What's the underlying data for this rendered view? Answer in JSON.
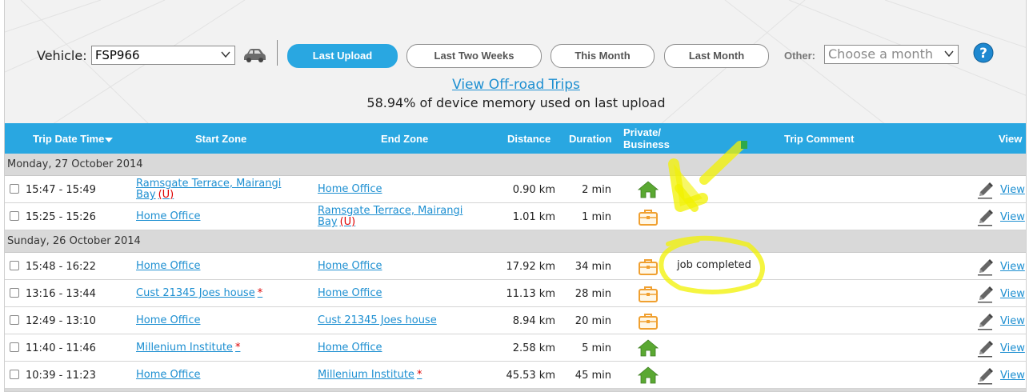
{
  "toolbar": {
    "vehicle_label": "Vehicle:",
    "vehicle_value": "FSP966",
    "buttons": [
      "Last Upload",
      "Last Two Weeks",
      "This Month",
      "Last Month"
    ],
    "active_button": "Last Upload",
    "other_label": "Other:",
    "month_placeholder": "Choose a month"
  },
  "offroad_link": "View Off-road Trips",
  "memory_text": "58.94% of device memory used on last upload",
  "table": {
    "headers": {
      "trip_datetime": "Trip Date Time",
      "start_zone": "Start Zone",
      "end_zone": "End Zone",
      "distance": "Distance",
      "duration": "Duration",
      "private_line1": "Private/",
      "private_line2": "Business",
      "trip_comment": "Trip Comment",
      "view": "View"
    },
    "groups": [
      {
        "date": "Monday, 27 October 2014",
        "rows": [
          {
            "time": "15:47 - 15:49",
            "start_line1": "Ramsgate Terrace, Mairangi",
            "start_line2": "Bay",
            "start_mark": "(U)",
            "end": "Home Office",
            "end_line2": "",
            "end_mark": "",
            "distance": "0.90 km",
            "duration": "2 min",
            "type": "private",
            "comment": "",
            "view": "View"
          },
          {
            "time": "15:25 - 15:26",
            "start_line1": "Home Office",
            "start_line2": "",
            "start_mark": "",
            "end": "Ramsgate Terrace, Mairangi",
            "end_line2": "Bay",
            "end_mark": "(U)",
            "distance": "1.01 km",
            "duration": "1 min",
            "type": "business",
            "comment": "",
            "view": "View"
          }
        ]
      },
      {
        "date": "Sunday, 26 October 2014",
        "rows": [
          {
            "time": "15:48 - 16:22",
            "start_line1": "Home Office",
            "start_line2": "",
            "start_mark": "",
            "end": "Home Office",
            "end_line2": "",
            "end_mark": "",
            "distance": "17.92 km",
            "duration": "34 min",
            "type": "business",
            "comment": "job completed",
            "view": "View"
          },
          {
            "time": "13:16 - 13:44",
            "start_line1": "Cust 21345 Joes house",
            "start_line2": "",
            "start_mark": "*",
            "end": "Home Office",
            "end_line2": "",
            "end_mark": "",
            "distance": "11.13 km",
            "duration": "28 min",
            "type": "business",
            "comment": "",
            "view": "View"
          },
          {
            "time": "12:49 - 13:10",
            "start_line1": "Home Office",
            "start_line2": "",
            "start_mark": "",
            "end": "Cust 21345 Joes house",
            "end_line2": "",
            "end_mark": "",
            "distance": "8.94 km",
            "duration": "20 min",
            "type": "business",
            "comment": "",
            "view": "View"
          },
          {
            "time": "11:40 - 11:46",
            "start_line1": "Millenium Institute",
            "start_line2": "",
            "start_mark": "*",
            "end": "Home Office",
            "end_line2": "",
            "end_mark": "",
            "distance": "2.58 km",
            "duration": "5 min",
            "type": "private",
            "comment": "",
            "view": "View"
          },
          {
            "time": "10:39 - 11:23",
            "start_line1": "Home Office",
            "start_line2": "",
            "start_mark": "",
            "end": "Millenium Institute",
            "end_line2": "",
            "end_mark": "*",
            "distance": "45.53 km",
            "duration": "45 min",
            "type": "private",
            "comment": "",
            "view": "View"
          }
        ]
      }
    ]
  },
  "colors": {
    "accent": "#29a7e1",
    "link": "#1d8fd1",
    "private_icon": "#5aa832",
    "business_icon": "#f0a030",
    "highlighter": "#f2f200"
  },
  "icons": {
    "private": "house-icon",
    "business": "briefcase-icon",
    "edit": "pencil-icon",
    "vehicle": "car-icon",
    "help": "help-icon"
  }
}
